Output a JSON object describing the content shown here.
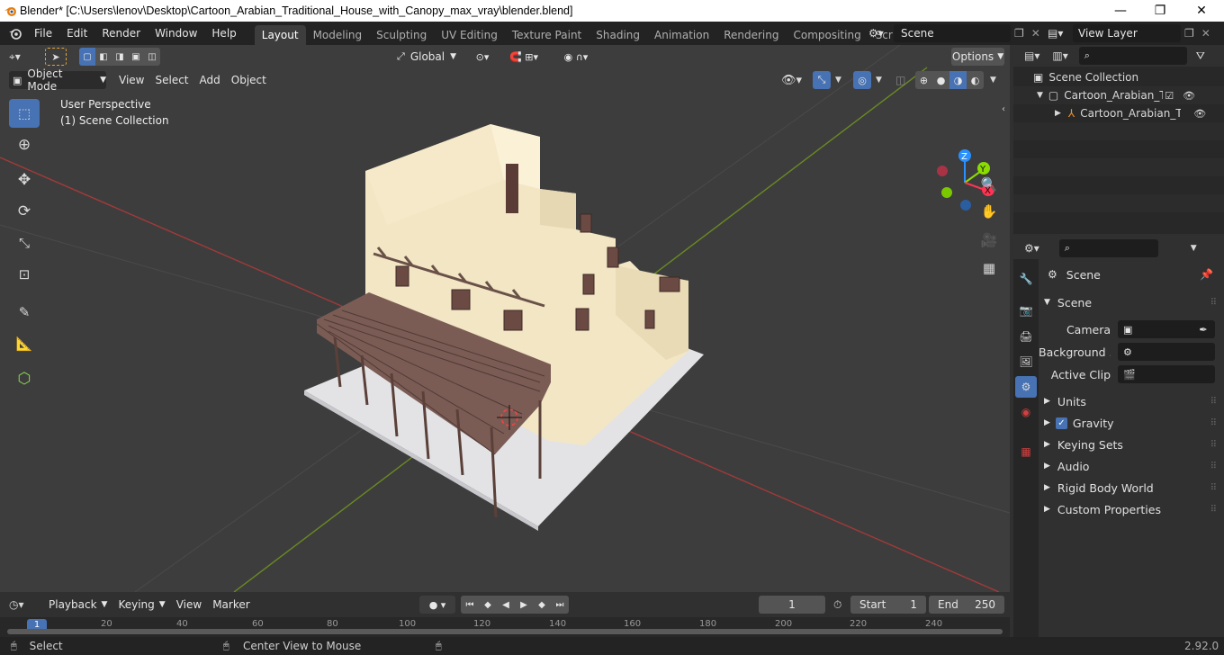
{
  "window": {
    "title": "Blender* [C:\\Users\\lenov\\Desktop\\Cartoon_Arabian_Traditional_House_with_Canopy_max_vray\\blender.blend]",
    "minimize": "—",
    "maximize": "❐",
    "close": "✕"
  },
  "menu": [
    "File",
    "Edit",
    "Render",
    "Window",
    "Help"
  ],
  "workspaces": [
    "Layout",
    "Modeling",
    "Sculpting",
    "UV Editing",
    "Texture Paint",
    "Shading",
    "Animation",
    "Rendering",
    "Compositing",
    "Scripting"
  ],
  "active_workspace": "Layout",
  "scene_field": "Scene",
  "view_layer_field": "View Layer",
  "viewport": {
    "transform_orientation": "Global",
    "options_label": "Options",
    "mode": "Object Mode",
    "header_menu": [
      "View",
      "Select",
      "Add",
      "Object"
    ],
    "overlay_text_1": "User Perspective",
    "overlay_text_2": "(1) Scene Collection",
    "gizmo_labels": {
      "x": "X",
      "y": "Y",
      "z": "Z"
    }
  },
  "outliner": {
    "root": "Scene Collection",
    "collection": "Cartoon_Arabian_Traditic",
    "object": "Cartoon_Arabian_Tra"
  },
  "properties": {
    "context": "Scene",
    "panel_title": "Scene",
    "camera_label": "Camera",
    "background_label": "Background ...",
    "active_clip_label": "Active Clip",
    "sections": [
      "Units",
      "Gravity",
      "Keying Sets",
      "Audio",
      "Rigid Body World",
      "Custom Properties"
    ],
    "gravity_checked": true
  },
  "timeline": {
    "menus": [
      "Playback",
      "Keying",
      "View",
      "Marker"
    ],
    "current_frame": "1",
    "start_label": "Start",
    "start_value": "1",
    "end_label": "End",
    "end_value": "250",
    "ruler": [
      "1",
      "20",
      "40",
      "60",
      "80",
      "100",
      "120",
      "140",
      "160",
      "180",
      "200",
      "220",
      "240"
    ]
  },
  "status": {
    "select": "Select",
    "center_view": "Center View to Mouse",
    "version": "2.92.0"
  },
  "colors": {
    "accent": "#4772b3",
    "x_axis": "#ff3352",
    "y_axis": "#8bdc00",
    "z_axis": "#2890ff"
  }
}
